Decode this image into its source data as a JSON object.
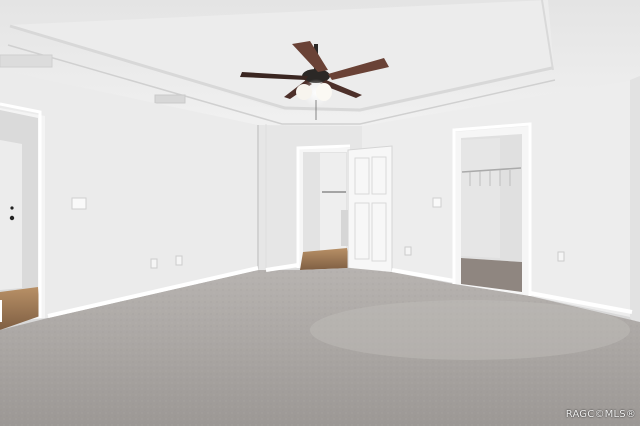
{
  "photo": {
    "watermark": "RAGC©MLS®",
    "scene_objects": [
      "ceiling-fan",
      "doorway-left",
      "door-center",
      "closet-doorway-right",
      "carpet-floor",
      "tray-ceiling"
    ]
  },
  "colors": {
    "wall": "#e9e9e9",
    "ceiling": "#eeeeee",
    "carpet": "#a9a5a2",
    "trim": "#ffffff",
    "fan_blade": "#6a4236",
    "fan_motor": "#2b2826",
    "hardwood": "#8a6a4c"
  }
}
